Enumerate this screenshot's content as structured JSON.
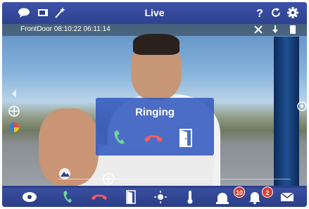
{
  "topbar": {
    "title": "Live",
    "left_icons": [
      "chat-bubble-icon",
      "window-icon",
      "magic-wand-icon"
    ],
    "right_icons": [
      "help-icon",
      "refresh-icon",
      "gear-icon"
    ]
  },
  "camera": {
    "info": "FrontDoor  08:10:22  06:11:14"
  },
  "ringing": {
    "label": "Ringing"
  },
  "colors": {
    "bar_blue": "#2d418f",
    "panel_blue": "#345abe",
    "accept_green": "#6fd39a",
    "reject_red": "#ff5a5a",
    "badge_red": "#e23b2e"
  },
  "bottombar": {
    "icons": [
      "camera-dome-icon",
      "phone-accept-icon",
      "phone-hangup-icon",
      "door-open-icon",
      "light-icon",
      "thermometer-icon",
      "alarm-light-icon",
      "bell-icon",
      "mail-icon"
    ],
    "badge_alarm": "10",
    "badge_bell": "2"
  }
}
